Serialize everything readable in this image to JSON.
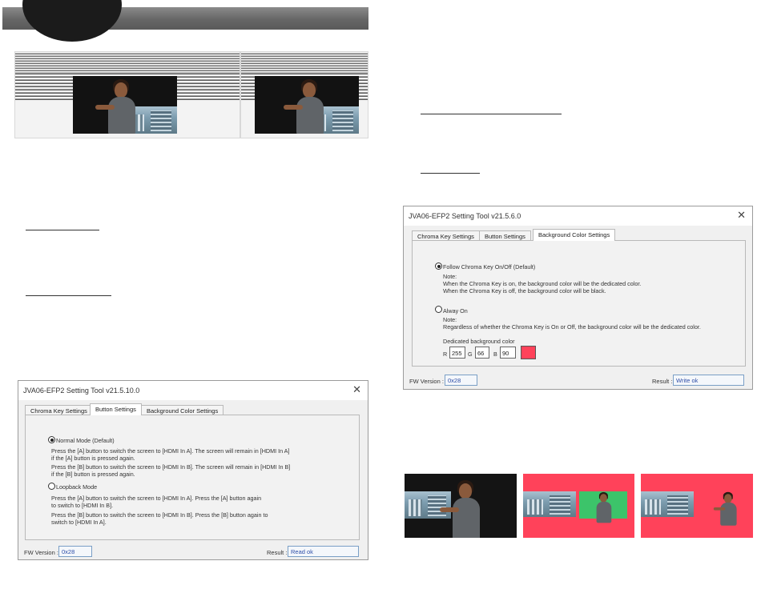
{
  "dialog_button": {
    "title": "JVA06-EFP2 Setting Tool v21.5.10.0",
    "close_glyph": "✕",
    "tabs": [
      "Chroma Key Settings",
      "Button Settings",
      "Background Color Settings"
    ],
    "active_tab": "Button Settings",
    "option_normal": {
      "label": "Normal Mode (Default)",
      "selected": true,
      "lines": [
        "Press the [A] button to switch the screen to [HDMI In A]. The screen will remain in [HDMI In A]",
        "if the [A] button is pressed again.",
        "Press the [B] button to switch the screen to [HDMI In B]. The screen will remain in [HDMI In  B]",
        "if the [B] button is pressed again."
      ]
    },
    "option_loopback": {
      "label": "Loopback Mode",
      "selected": false,
      "lines": [
        "Press the [A] button to switch the screen to [HDMI In A]. Press the [A] button again",
        "to switch to [HDMI In B].",
        "Press the [B] button to switch the screen to [HDMI In B]. Press the  [B] button again to",
        "switch to [HDMI In A]."
      ]
    },
    "fw_label": "FW Version :",
    "fw_value": "0x28",
    "result_label": "Result :",
    "result_value": "Read ok"
  },
  "dialog_bg": {
    "title": "JVA06-EFP2 Setting Tool v21.5.6.0",
    "close_glyph": "✕",
    "tabs": [
      "Chroma Key Settings",
      "Button Settings",
      "Background Color Settings"
    ],
    "active_tab": "Background Color Settings",
    "option_follow": {
      "label": "Follow Chroma Key On/Off (Default)",
      "selected": true,
      "lines": [
        "Note:",
        "When the Chroma Key is on, the background color will be the dedicated color.",
        "When the Chroma Key is off, the background color will be black."
      ]
    },
    "option_always": {
      "label": "Alway On",
      "selected": false,
      "lines": [
        "Note:",
        "Regardless of whether the Chroma Key is On or Off, the background color will be the dedicated color."
      ]
    },
    "dedicated_label": "Dedicated background color",
    "r_label": "R",
    "r_value": "255",
    "g_label": "G",
    "g_value": "66",
    "b_label": "B",
    "b_value": "90",
    "swatch_color": "#ff425a",
    "fw_label": "FW Version :",
    "fw_value": "0x28",
    "result_label": "Result :",
    "result_value": "Write ok"
  },
  "colors": {
    "header_band": "#666666",
    "circle": "#1b1b1b",
    "chroma_green": "#3cc46a",
    "background_red": "#ff425a"
  }
}
